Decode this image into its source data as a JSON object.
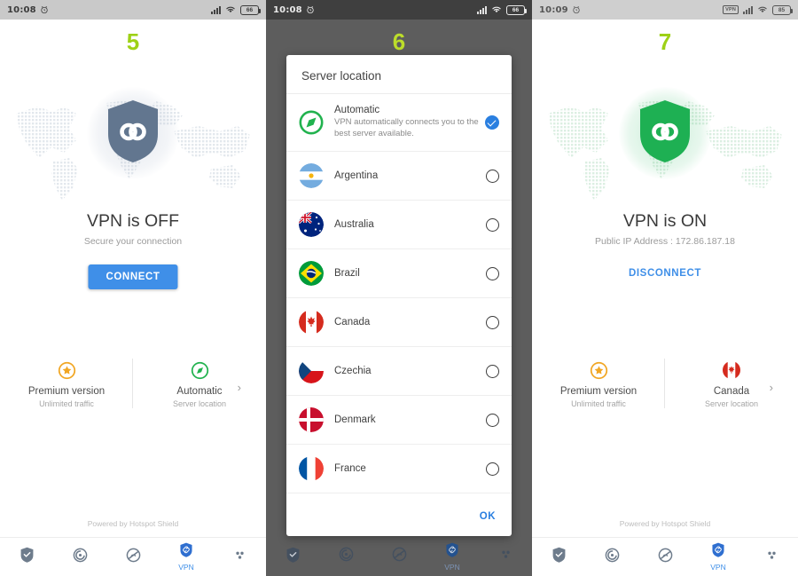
{
  "panels": [
    {
      "step": "5",
      "statusbar": {
        "time": "10:08",
        "battery": "66",
        "alarm_icon": "alarm-icon",
        "signal_icon": "signal-icon",
        "wifi_icon": "wifi-icon"
      },
      "hero": {
        "shield_icon": "shield-link-icon",
        "title": "VPN is OFF",
        "subtitle": "Secure your connection",
        "button": "CONNECT"
      },
      "info": {
        "premium_title": "Premium version",
        "premium_sub": "Unlimited traffic",
        "premium_icon": "star-badge-icon",
        "location_title": "Automatic",
        "location_sub": "Server location",
        "location_icon": "compass-icon",
        "chevron": "›"
      },
      "powered": "Powered by Hotspot Shield"
    },
    {
      "step": "6",
      "statusbar": {
        "time": "10:08",
        "battery": "66",
        "alarm_icon": "alarm-icon",
        "signal_icon": "signal-icon",
        "wifi_icon": "wifi-icon"
      },
      "dialog": {
        "title": "Server location",
        "ok_label": "OK",
        "items": [
          {
            "name": "Automatic",
            "desc": "VPN automatically connects you to the best server available.",
            "icon": "compass-icon",
            "selected": true
          },
          {
            "name": "Argentina",
            "icon": "flag-argentina",
            "selected": false
          },
          {
            "name": "Australia",
            "icon": "flag-australia",
            "selected": false
          },
          {
            "name": "Brazil",
            "icon": "flag-brazil",
            "selected": false
          },
          {
            "name": "Canada",
            "icon": "flag-canada",
            "selected": false
          },
          {
            "name": "Czechia",
            "icon": "flag-czechia",
            "selected": false
          },
          {
            "name": "Denmark",
            "icon": "flag-denmark",
            "selected": false
          },
          {
            "name": "France",
            "icon": "flag-france",
            "selected": false
          }
        ]
      }
    },
    {
      "step": "7",
      "statusbar": {
        "time": "10:09",
        "battery": "85",
        "vpn_badge": "VPN",
        "alarm_icon": "alarm-icon",
        "signal_icon": "signal-icon",
        "wifi_icon": "wifi-icon"
      },
      "hero": {
        "shield_icon": "shield-link-icon",
        "title": "VPN is ON",
        "subtitle": "Public IP Address : 172.86.187.18",
        "button": "DISCONNECT"
      },
      "info": {
        "premium_title": "Premium version",
        "premium_sub": "Unlimited traffic",
        "premium_icon": "star-badge-icon",
        "location_title": "Canada",
        "location_sub": "Server location",
        "location_icon": "flag-canada",
        "chevron": "›"
      },
      "powered": "Powered by Hotspot Shield"
    }
  ],
  "navbar": {
    "items": [
      {
        "icon": "shield-check-icon",
        "label": ""
      },
      {
        "icon": "cleaner-icon",
        "label": ""
      },
      {
        "icon": "boost-icon",
        "label": ""
      },
      {
        "icon": "vpn-shield-icon",
        "label": "VPN"
      },
      {
        "icon": "more-dots-icon",
        "label": ""
      }
    ]
  },
  "colors": {
    "accent_blue": "#3f8fe8",
    "green": "#21b24e",
    "step_green": "#9ed116",
    "gold": "#f1a623",
    "shield_off": "#62768f"
  }
}
